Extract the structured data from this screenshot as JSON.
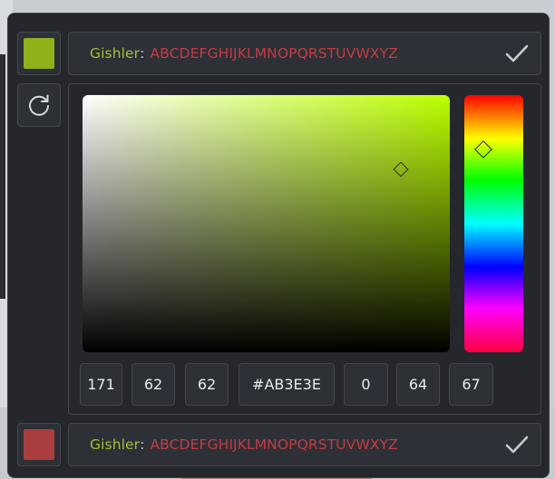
{
  "current": {
    "swatch_color": "#8fb21b",
    "name_label": "Gishler",
    "colon": ":",
    "alphabet": "ABCDEFGHIJKLMNOPQRSTUVWXYZ",
    "confirm_icon": "check-icon"
  },
  "reset_icon": "refresh-icon",
  "picker": {
    "hue_color": "#bcff00",
    "fields": {
      "r": "171",
      "g": "62",
      "b": "62",
      "hex": "#AB3E3E",
      "h": "0",
      "s": "64",
      "v": "67"
    }
  },
  "selected": {
    "swatch_color": "#ab3e3e",
    "name_label": "Gishler",
    "colon": ":",
    "alphabet": "ABCDEFGHIJKLMNOPQRSTUVWXYZ",
    "confirm_icon": "check-icon"
  }
}
